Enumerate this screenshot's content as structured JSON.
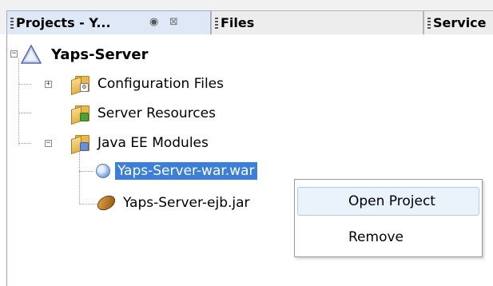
{
  "tabs": [
    {
      "title": "Projects - Y...",
      "minimize_glyph": "◉",
      "close_glyph": "⊠"
    },
    {
      "title": "Files"
    },
    {
      "title": "Service"
    }
  ],
  "tree": {
    "root": {
      "label": "Yaps-Server",
      "icon": "project-triangle-icon",
      "toggle": "−"
    },
    "children": [
      {
        "label": "Configuration Files",
        "icon": "config-folder-icon",
        "toggle": "+"
      },
      {
        "label": "Server Resources",
        "icon": "resources-folder-icon"
      },
      {
        "label": "Java EE Modules",
        "icon": "modules-folder-icon",
        "toggle": "−"
      }
    ],
    "modules": [
      {
        "label": "Yaps-Server-war.war",
        "icon": "globe-icon",
        "selected": true
      },
      {
        "label": "Yaps-Server-ejb.jar",
        "icon": "bean-icon"
      }
    ]
  },
  "context_menu": {
    "items": [
      {
        "label": "Open Project"
      },
      {
        "label": "Remove"
      }
    ]
  },
  "colors": {
    "selection": "#3c7fd8",
    "menu_hover": "#eaf2fb",
    "active_tab": "#dfe8f6"
  }
}
